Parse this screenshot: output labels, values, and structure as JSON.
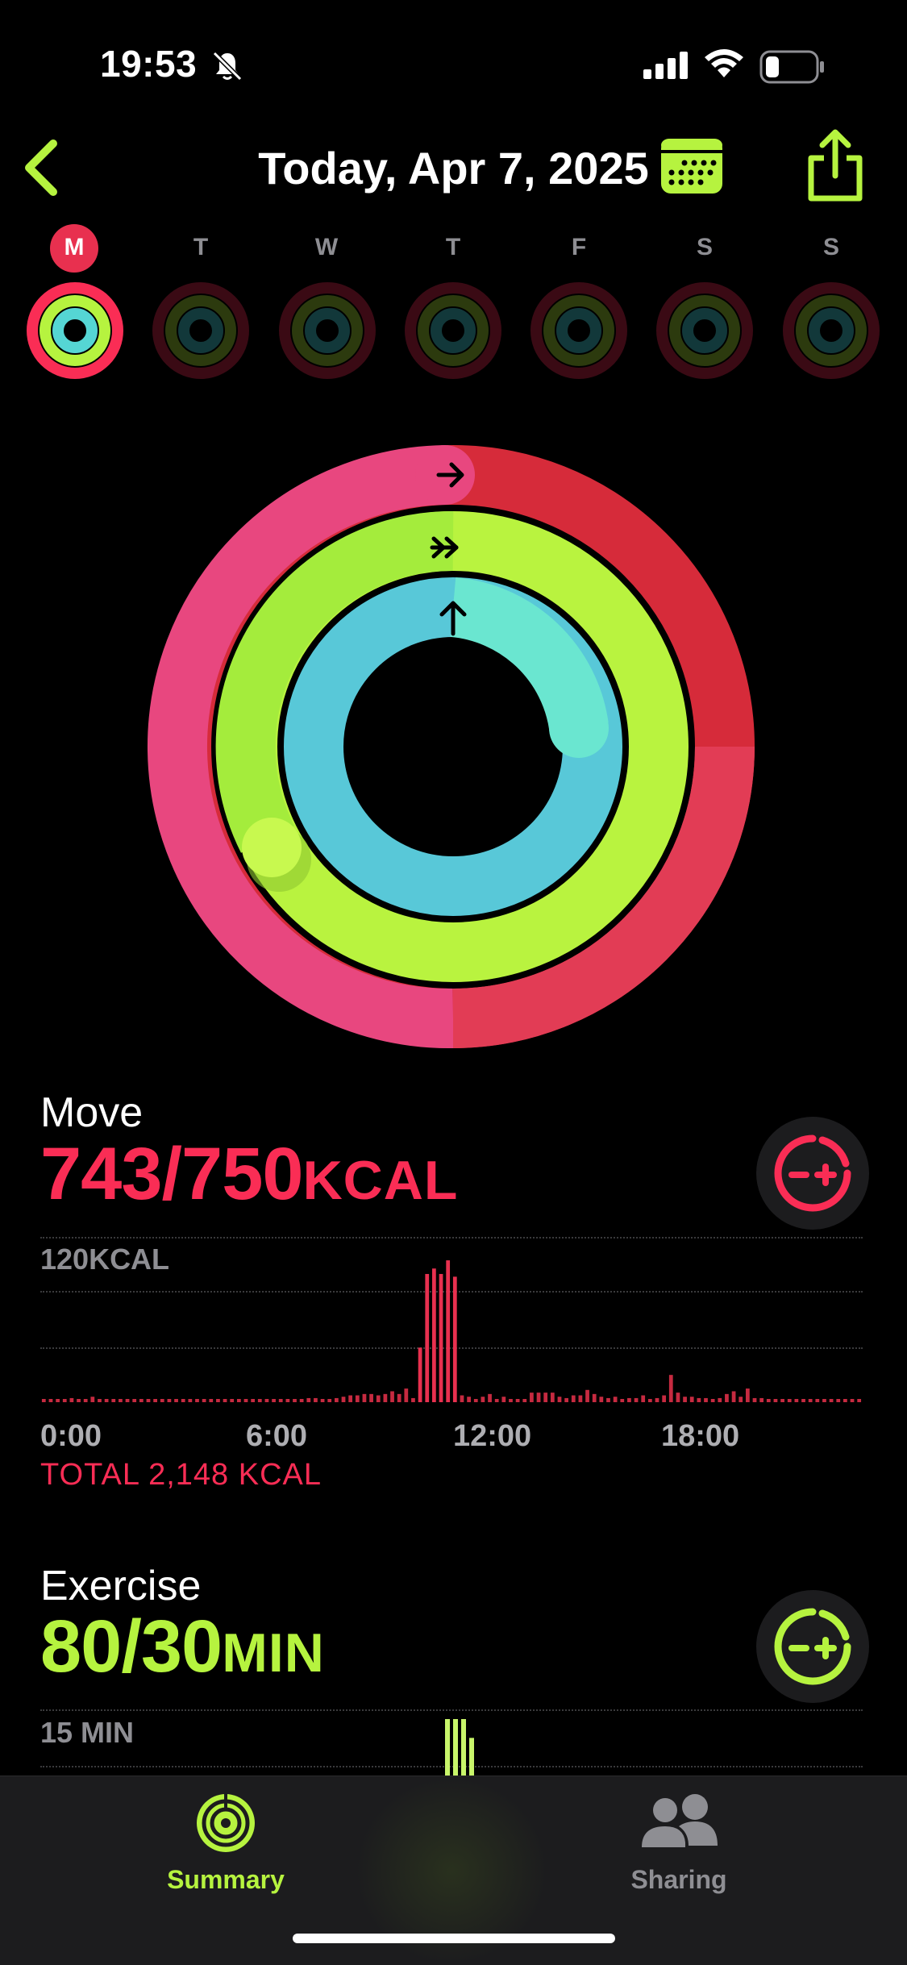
{
  "status_bar": {
    "time": "19:53"
  },
  "header": {
    "title": "Today, Apr 7, 2025"
  },
  "week": {
    "days": [
      "M",
      "T",
      "W",
      "T",
      "F",
      "S",
      "S"
    ],
    "selected_index": 0
  },
  "rings": {
    "move_fraction": 0.99,
    "exercise_fraction": 2.67,
    "stand_fraction": 1.3
  },
  "move": {
    "label": "Move",
    "value": "743/750",
    "unit": "KCAL",
    "scale_label": "120KCAL",
    "x_ticks": [
      "0:00",
      "6:00",
      "12:00",
      "18:00"
    ],
    "total": "TOTAL 2,148 KCAL",
    "color": "#fa2d55"
  },
  "exercise": {
    "label": "Exercise",
    "value": "80/30",
    "unit": "MIN",
    "scale_label": "15 MIN",
    "color": "#b6f33f"
  },
  "tabs": [
    {
      "label": "Summary",
      "active": true
    },
    {
      "label": "Sharing",
      "active": false
    }
  ],
  "chart_data": [
    {
      "type": "bar",
      "title": "",
      "series": [
        {
          "name": "",
          "values": [
            2,
            2,
            2,
            2,
            3,
            2,
            2,
            4,
            2,
            2,
            2,
            2,
            2,
            2,
            2,
            2,
            2,
            2,
            2,
            2,
            2,
            2,
            2,
            2,
            2,
            2,
            2,
            2,
            2,
            2,
            2,
            2,
            2,
            2,
            2,
            2,
            2,
            2,
            3,
            3,
            2,
            2,
            3,
            4,
            5,
            5,
            6,
            6,
            5,
            6,
            8,
            6,
            10,
            3,
            40,
            94,
            98,
            94,
            104,
            92,
            5,
            4,
            2,
            4,
            6,
            2,
            4,
            2,
            2,
            2,
            7,
            7,
            7,
            7,
            4,
            3,
            5,
            5,
            9,
            6,
            4,
            3,
            4,
            2,
            3,
            3,
            5,
            2,
            3,
            5,
            20,
            7,
            4,
            4,
            3,
            3,
            2,
            3,
            6,
            8,
            4,
            10,
            3,
            3,
            2,
            2,
            2,
            2,
            2,
            2,
            2,
            2,
            2,
            2,
            2,
            2,
            2,
            2
          ]
        }
      ],
      "x_range": [
        "0:00",
        "24:00"
      ],
      "ylim": [
        0,
        120
      ],
      "x_ticks": [
        "0:00",
        "6:00",
        "12:00",
        "18:00"
      ],
      "y_label": "120KCAL"
    },
    {
      "type": "bar",
      "title": "",
      "series": [
        {
          "name": "",
          "values": [
            15,
            15,
            15,
            10
          ]
        }
      ],
      "ylim": [
        0,
        15
      ],
      "y_label": "15 MIN"
    }
  ]
}
